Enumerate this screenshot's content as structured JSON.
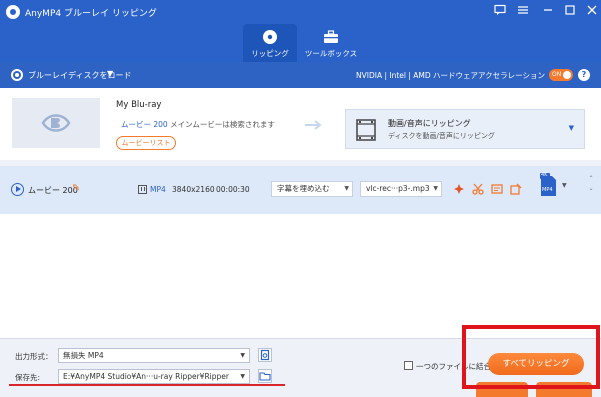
{
  "app": {
    "title": "AnyMP4 ブルーレイ リッピング"
  },
  "window_controls": [
    "feedback-icon",
    "menu-icon",
    "minimize-icon",
    "maximize-icon",
    "close-icon"
  ],
  "tabs": [
    {
      "label": "リッピング",
      "icon": "disc-icon",
      "active": true
    },
    {
      "label": "ツールボックス",
      "icon": "toolbox-icon",
      "active": false
    }
  ],
  "loadbar": {
    "load_label": "ブルーレイディスクをロード",
    "accel_label": "NVIDIA | Intel | AMD ハードウェアアクセラレーション",
    "toggle_label": "ON"
  },
  "source": {
    "disc_name": "My Blu-ray",
    "movie_count_text": "ムービー 200",
    "found_text": " メインムービーは検索されます",
    "movielist_button": "ムービーリスト",
    "profile_title": "動画/音声にリッピング",
    "profile_subtitle": "ディスクを動画/音声にリッピング"
  },
  "title_row": {
    "name": "ムービー 200",
    "format": "MP4",
    "resolution": "3840x2160",
    "duration": "00:00:30",
    "subtitle_select": "字幕を埋め込む",
    "audio_select": "vlc-rec···p3-.mp3",
    "output_format_badge": "MP4",
    "output_resolution_badge": "4K"
  },
  "bottom": {
    "output_format_label": "出力形式：",
    "output_format_value": "無損失 MP4",
    "save_label": "保存先:",
    "save_path": "E:¥AnyMP4 Studio¥An···u-ray Ripper¥Ripper",
    "merge_label": "一つのファイルに結合",
    "rip_all_button": "すべてリッピング"
  },
  "colors": {
    "header_blue": "#2b62c9",
    "accent_orange": "#f47a2e",
    "highlight_red": "#e0151b"
  }
}
